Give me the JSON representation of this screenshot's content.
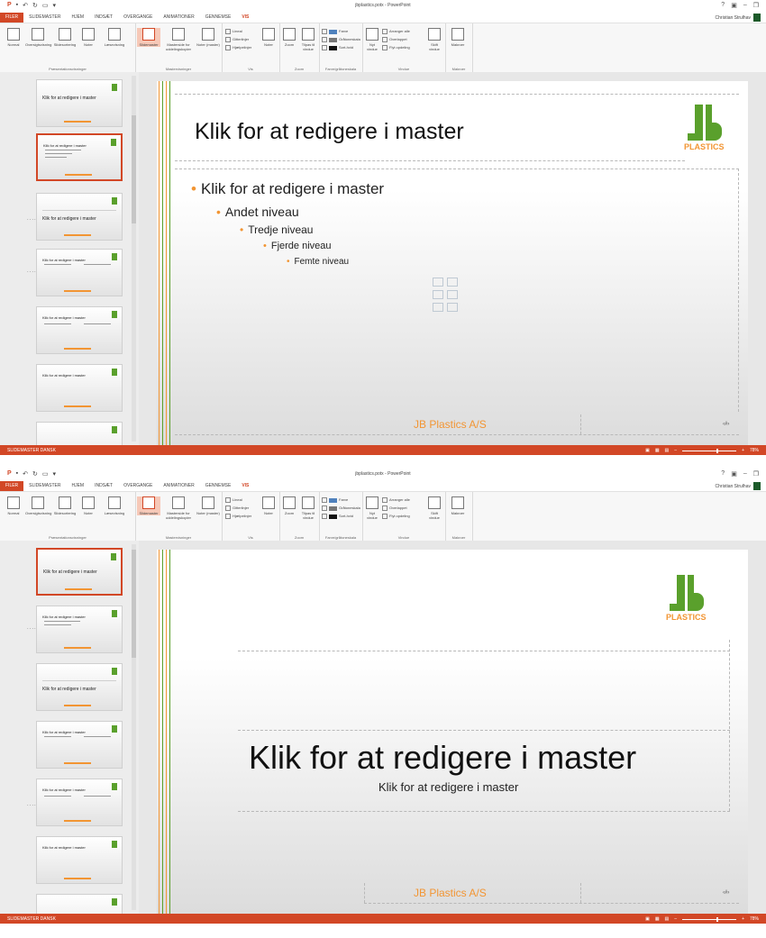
{
  "windows": [
    {
      "title": "jbplastics.potx - PowerPoint",
      "tabs": [
        "FILER",
        "SLIDEMASTER",
        "HJEM",
        "INDSÆT",
        "OVERGANGE",
        "ANIMATIONER",
        "GENNEMSE",
        "VIS"
      ],
      "user": "Christian Strulhav",
      "ribbon": {
        "groups": [
          "Præsentationsvisninger",
          "Mastervisninger",
          "Vis",
          "Zoom",
          "Farve/gråtoneskala",
          "Vindue",
          "Makroer"
        ],
        "buttons": [
          "Normal",
          "Oversigtsvisning",
          "Slidesortering",
          "Noter",
          "Læsevisning",
          "Slidemaster",
          "Masterside for uddelingskopier",
          "Noter (master)",
          "Zoom",
          "Tilpas til vindue",
          "Nyt vindue",
          "Skift vindue",
          "Makroer"
        ],
        "checks": [
          "Lineal",
          "Gitterlinjer",
          "Hjælpelinjer"
        ],
        "color_opts": [
          "Farve",
          "Gråtoneskala",
          "Sort-hvid"
        ],
        "window_opts": [
          "Arranger alle",
          "Overlappet",
          "Flyt opdeling"
        ]
      },
      "thumbs": [
        {
          "title": "Klik for at redigere i master",
          "active": false
        },
        {
          "title": "Klik for at redigere i master",
          "active": true
        },
        {
          "title": "Klik for at redigere i master",
          "active": false
        },
        {
          "title": "Klik for at redigere i master",
          "active": false
        },
        {
          "title": "Klik for at redigere i master",
          "active": false
        },
        {
          "title": "Klik for at redigere i master",
          "active": false
        }
      ],
      "slide": {
        "title": "Klik for at redigere i master",
        "bullets": [
          "Klik for at redigere i master",
          "Andet niveau",
          "Tredje niveau",
          "Fjerde niveau",
          "Femte niveau"
        ],
        "footer": "JB Plastics A/S",
        "page": "‹#›",
        "logo": "PLASTICS"
      },
      "status": {
        "left": "SLIDEMASTER   DANSK",
        "zoom": "78%"
      }
    },
    {
      "title": "jbplastics.potx - PowerPoint",
      "tabs": [
        "FILER",
        "SLIDEMASTER",
        "HJEM",
        "INDSÆT",
        "OVERGANGE",
        "ANIMATIONER",
        "GENNEMSE",
        "VIS"
      ],
      "user": "Christian Strulhav",
      "ribbon": {
        "groups": [
          "Præsentationsvisninger",
          "Mastervisninger",
          "Vis",
          "Zoom",
          "Farve/gråtoneskala",
          "Vindue",
          "Makroer"
        ],
        "buttons": [
          "Normal",
          "Oversigtsvisning",
          "Slidesortering",
          "Noter",
          "Læsevisning",
          "Slidemaster",
          "Masterside for uddelingskopier",
          "Noter (master)",
          "Zoom",
          "Tilpas til vindue",
          "Nyt vindue",
          "Skift vindue",
          "Makroer"
        ],
        "checks": [
          "Lineal",
          "Gitterlinjer",
          "Hjælpelinjer"
        ],
        "color_opts": [
          "Farve",
          "Gråtoneskala",
          "Sort-hvid"
        ],
        "window_opts": [
          "Arranger alle",
          "Overlappet",
          "Flyt opdeling"
        ]
      },
      "thumbs": [
        {
          "title": "Klik for at redigere i master",
          "active": true
        },
        {
          "title": "Klik for at redigere i master",
          "active": false
        },
        {
          "title": "Klik for at redigere i master",
          "active": false
        },
        {
          "title": "Klik for at redigere i master",
          "active": false
        },
        {
          "title": "Klik for at redigere i master",
          "active": false
        },
        {
          "title": "Klik for at redigere i master",
          "active": false
        }
      ],
      "slide": {
        "title": "Klik for at redigere i master",
        "subtitle": "Klik for at redigere i master",
        "footer": "JB Plastics A/S",
        "page": "‹#›",
        "logo": "PLASTICS"
      },
      "status": {
        "left": "SLIDEMASTER   DANSK",
        "zoom": "78%"
      }
    }
  ],
  "colors": {
    "accent": "#d24726",
    "logo_green": "#5aa02c",
    "logo_orange": "#f29533"
  }
}
